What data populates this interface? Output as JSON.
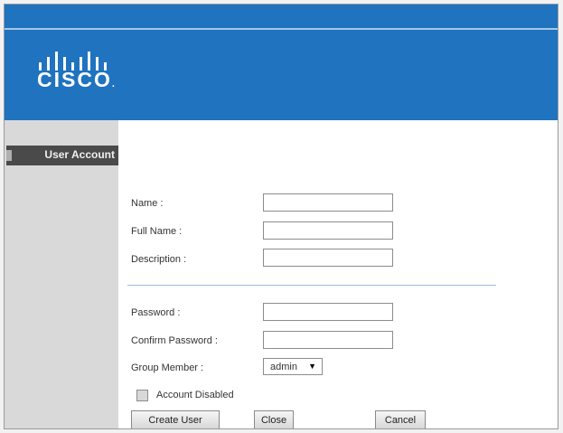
{
  "brand": {
    "logo_text": "CISCO",
    "logo_dot": ".",
    "colors": {
      "banner": "#1f73bf",
      "sidebar_header": "#4a4a4a"
    }
  },
  "sidebar": {
    "section_title": "User Account"
  },
  "form": {
    "name_label": "Name :",
    "full_name_label": "Full Name :",
    "description_label": "Description :",
    "password_label": "Password :",
    "confirm_password_label": "Confirm Password :",
    "group_member_label": "Group Member :",
    "group_member_value": "admin",
    "account_disabled_label": "Account Disabled",
    "account_disabled_checked": false,
    "name_value": "",
    "full_name_value": "",
    "description_value": "",
    "password_value": "",
    "confirm_password_value": ""
  },
  "buttons": {
    "create_user": "Create User",
    "close": "Close",
    "cancel": "Cancel"
  }
}
